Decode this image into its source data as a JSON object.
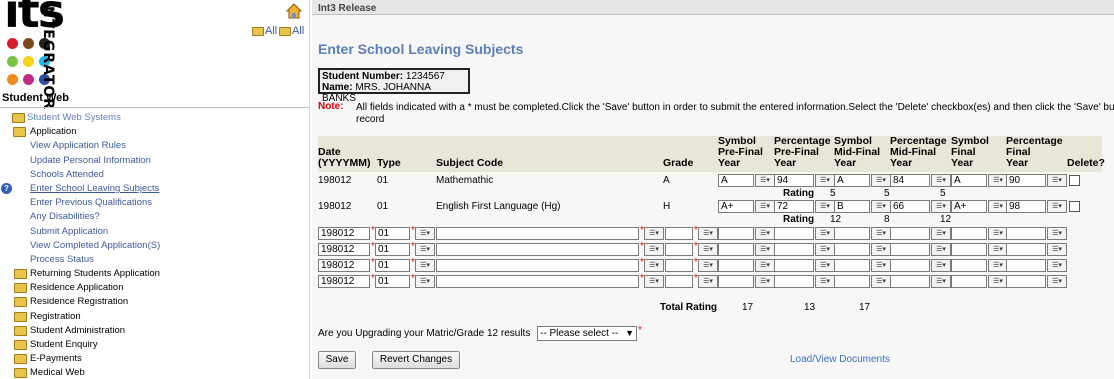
{
  "logo": {
    "wordmark": "its",
    "tagline": "NTEGRATOR"
  },
  "sidebar": {
    "expand_all": "All",
    "collapse_all": "All",
    "title": "Student Web",
    "tree": [
      {
        "label": "Student Web Systems"
      },
      {
        "label": "Application"
      },
      {
        "label": "View Application Rules"
      },
      {
        "label": "Update Personal Information"
      },
      {
        "label": "Schools Attended"
      },
      {
        "label": "Enter School Leaving Subjects"
      },
      {
        "label": "Enter Previous Qualifications"
      },
      {
        "label": "Any Disabilities?"
      },
      {
        "label": "Submit Application"
      },
      {
        "label": "View Completed Application(S)"
      },
      {
        "label": "Process Status"
      },
      {
        "label": "Returning Students Application"
      },
      {
        "label": "Residence Application"
      },
      {
        "label": "Residence Registration"
      },
      {
        "label": "Registration"
      },
      {
        "label": "Student Administration"
      },
      {
        "label": "Student Enquiry"
      },
      {
        "label": "E-Payments"
      },
      {
        "label": "Medical Web"
      }
    ]
  },
  "main": {
    "release": "Int3 Release",
    "title": "Enter School Leaving Subjects",
    "student_number_label": "Student Number:",
    "student_number": "1234567",
    "name_label": "Name:",
    "name": "MRS.  JOHANNA BANKS",
    "note_label": "Note:",
    "note_text": "All fields indicated with a * must be completed.Click the 'Save' button in order to submit the entered information.Select the 'Delete' checkbox(es) and then click the 'Save' bu",
    "note_text2": "record"
  },
  "table": {
    "headers": {
      "date": "Date\n(YYYYMM)",
      "type": "Type",
      "subject": "Subject Code",
      "grade": "Grade",
      "sym_pre": "Symbol\nPre-Final\nYear",
      "pct_pre": "Percentage\nPre-Final\nYear",
      "sym_mid": "Symbol\nMid-Final\nYear",
      "pct_mid": "Percentage\nMid-Final\nYear",
      "sym_fin": "Symbol\nFinal\nYear",
      "pct_fin": "Percentage\nFinal\nYear",
      "del": "Delete?"
    },
    "rating_label": "Rating",
    "rows": [
      {
        "date": "198012",
        "type": "01",
        "subject": "Mathemathic",
        "grade": "A",
        "sym_pre": "A",
        "pct_pre": "94",
        "sym_mid": "A",
        "pct_mid": "84",
        "sym_fin": "A",
        "pct_fin": "90",
        "r_pre": "5",
        "r_mid": "5",
        "r_fin": "5"
      },
      {
        "date": "198012",
        "type": "01",
        "subject": "English First Language (Hg)",
        "grade": "H",
        "sym_pre": "A+",
        "pct_pre": "72",
        "sym_mid": "B",
        "pct_mid": "66",
        "sym_fin": "A+",
        "pct_fin": "98",
        "r_pre": "12",
        "r_mid": "8",
        "r_fin": "12"
      }
    ],
    "new_rows": [
      {
        "date": "198012",
        "type": "01"
      },
      {
        "date": "198012",
        "type": "01"
      },
      {
        "date": "198012",
        "type": "01"
      },
      {
        "date": "198012",
        "type": "01"
      }
    ],
    "total_label": "Total Rating",
    "total_pre": "17",
    "total_mid": "13",
    "total_fin": "17"
  },
  "upgrade": {
    "question": "Are you Upgrading your Matric/Grade 12 results",
    "selected": "-- Please select --"
  },
  "buttons": {
    "save": "Save",
    "revert": "Revert Changes",
    "docs": "Load/View Documents"
  },
  "colors": {
    "accent": "#5b7fba",
    "required": "#dd0000",
    "header_band": "#e8e6d8"
  }
}
